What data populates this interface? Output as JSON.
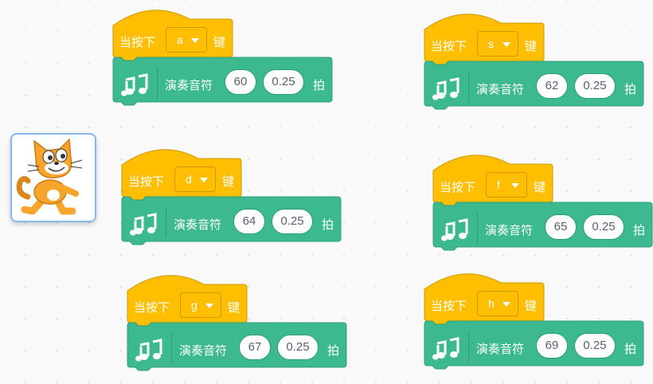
{
  "colors": {
    "events": "#FFBF00",
    "events_border": "#CC9900",
    "music": "#3CB98E",
    "music_border": "#2E9E77"
  },
  "sprite": {
    "name_icon": "cat-sprite-icon"
  },
  "scripts": [
    {
      "hat": {
        "prefix": "当按下",
        "key": "a",
        "suffix": "键"
      },
      "block": {
        "label": "演奏音符",
        "note": "60",
        "beats": "0.25",
        "unit": "拍"
      }
    },
    {
      "hat": {
        "prefix": "当按下",
        "key": "s",
        "suffix": "键"
      },
      "block": {
        "label": "演奏音符",
        "note": "62",
        "beats": "0.25",
        "unit": "拍"
      }
    },
    {
      "hat": {
        "prefix": "当按下",
        "key": "d",
        "suffix": "键"
      },
      "block": {
        "label": "演奏音符",
        "note": "64",
        "beats": "0.25",
        "unit": "拍"
      }
    },
    {
      "hat": {
        "prefix": "当按下",
        "key": "f",
        "suffix": "键"
      },
      "block": {
        "label": "演奏音符",
        "note": "65",
        "beats": "0.25",
        "unit": "拍"
      }
    },
    {
      "hat": {
        "prefix": "当按下",
        "key": "g",
        "suffix": "键"
      },
      "block": {
        "label": "演奏音符",
        "note": "67",
        "beats": "0.25",
        "unit": "拍"
      }
    },
    {
      "hat": {
        "prefix": "当按下",
        "key": "h",
        "suffix": "键"
      },
      "block": {
        "label": "演奏音符",
        "note": "69",
        "beats": "0.25",
        "unit": "拍"
      }
    }
  ]
}
